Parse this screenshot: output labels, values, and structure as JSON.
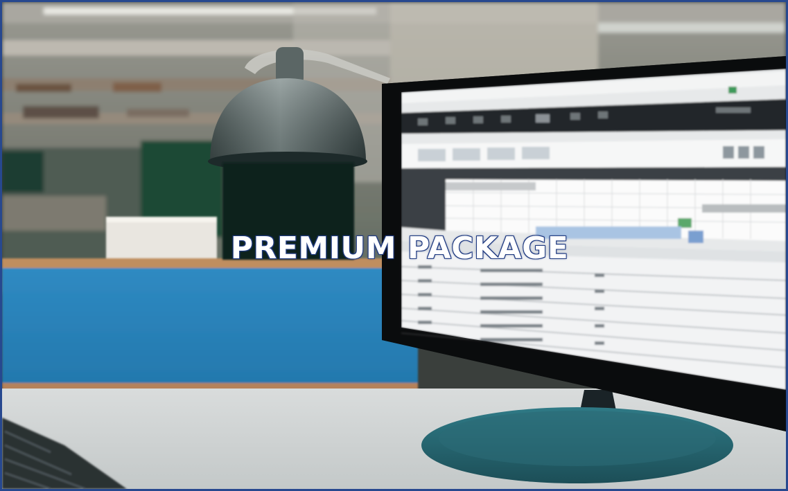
{
  "image": {
    "headline": "PREMIUM PACKAGE",
    "border_color": "#27488f",
    "headline_stroke_color": "#2f4f9e",
    "scene_objects": [
      "desk-lamp",
      "computer-monitor",
      "keyboard",
      "blue-cabinet",
      "desk"
    ]
  }
}
